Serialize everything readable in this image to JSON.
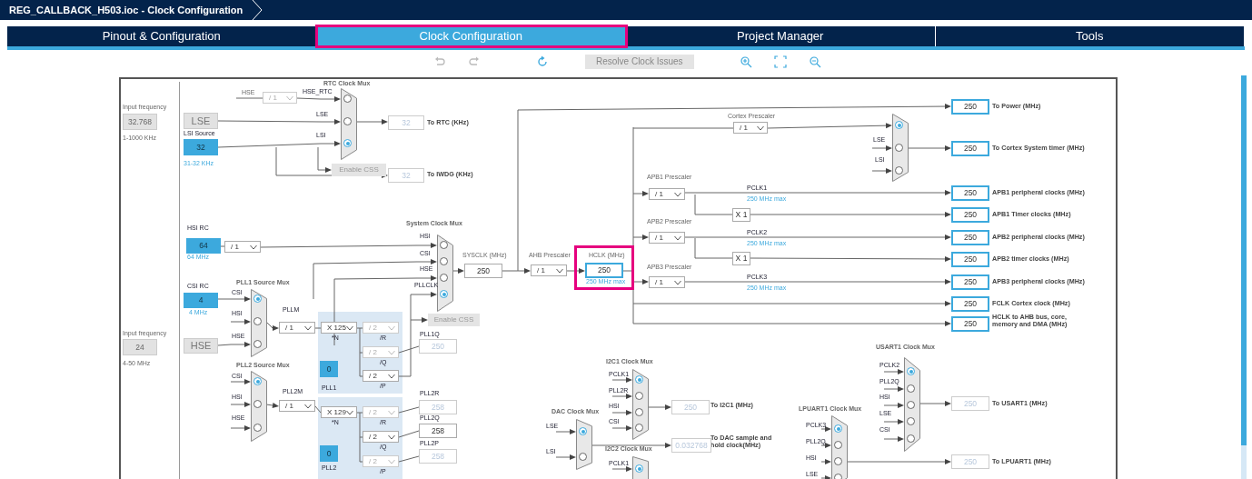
{
  "window": {
    "title": "REG_CALLBACK_H503.ioc - Clock Configuration"
  },
  "tabs": [
    {
      "label": "Pinout & Configuration",
      "selected": false
    },
    {
      "label": "Clock Configuration",
      "selected": true,
      "highlighted": true
    },
    {
      "label": "Project Manager",
      "selected": false
    },
    {
      "label": "Tools",
      "selected": false
    }
  ],
  "toolbar": {
    "resolve_button": {
      "label": "Resolve Clock Issues",
      "disabled": true
    }
  },
  "diagram": {
    "labels": [
      {
        "text": "Input frequency",
        "kind": "caption"
      },
      {
        "text": "1-1000 KHz",
        "kind": "caption"
      },
      {
        "text": "LSI Source",
        "kind": "signal"
      },
      {
        "text": "31-32 KHz",
        "kind": "range"
      },
      {
        "text": "HSE",
        "kind": "caption"
      },
      {
        "text": "To RTC (KHz)",
        "kind": "output"
      },
      {
        "text": "To IWDG (KHz)",
        "kind": "output"
      },
      {
        "text": "HSI RC",
        "kind": "signal"
      },
      {
        "text": "64 MHz",
        "kind": "range"
      },
      {
        "text": "CSI RC",
        "kind": "signal"
      },
      {
        "text": "4 MHz",
        "kind": "range"
      },
      {
        "text": "Input frequency",
        "kind": "caption"
      },
      {
        "text": "4-50 MHz",
        "kind": "caption"
      },
      {
        "text": "PLLM",
        "kind": "signal"
      },
      {
        "text": "*N",
        "kind": "signal"
      },
      {
        "text": "/R",
        "kind": "signal"
      },
      {
        "text": "/Q",
        "kind": "signal"
      },
      {
        "text": "/P",
        "kind": "signal"
      },
      {
        "text": "PLL1",
        "kind": "signal"
      },
      {
        "text": "PLL2M",
        "kind": "signal"
      },
      {
        "text": "*N",
        "kind": "signal"
      },
      {
        "text": "/R",
        "kind": "signal"
      },
      {
        "text": "/Q",
        "kind": "signal"
      },
      {
        "text": "PLL2",
        "kind": "signal"
      },
      {
        "text": "/P",
        "kind": "signal"
      },
      {
        "text": "PLL1Q",
        "kind": "signal"
      },
      {
        "text": "PLL2R",
        "kind": "signal"
      },
      {
        "text": "PLL2Q",
        "kind": "signal"
      },
      {
        "text": "PLL2P",
        "kind": "signal"
      },
      {
        "text": "SYSCLK (MHz)",
        "kind": "caption"
      },
      {
        "text": "AHB Prescaler",
        "kind": "caption"
      },
      {
        "text": "HCLK (MHz)",
        "kind": "caption"
      },
      {
        "text": "250 MHz max",
        "kind": "range"
      },
      {
        "text": "APB1 Prescaler",
        "kind": "caption"
      },
      {
        "text": "APB2 Prescaler",
        "kind": "caption"
      },
      {
        "text": "APB3 Prescaler",
        "kind": "caption"
      },
      {
        "text": "Cortex Prescaler",
        "kind": "caption"
      },
      {
        "text": "PCLK1",
        "kind": "signal"
      },
      {
        "text": "250 MHz max",
        "kind": "range"
      },
      {
        "text": "PCLK2",
        "kind": "signal"
      },
      {
        "text": "250 MHz max",
        "kind": "range"
      },
      {
        "text": "PCLK3",
        "kind": "signal"
      },
      {
        "text": "250 MHz max",
        "kind": "range"
      },
      {
        "text": "To Power (MHz)",
        "kind": "output"
      },
      {
        "text": "To Cortex System timer (MHz)",
        "kind": "output"
      },
      {
        "text": "APB1 peripheral clocks (MHz)",
        "kind": "output"
      },
      {
        "text": "APB1 Timer clocks (MHz)",
        "kind": "output"
      },
      {
        "text": "APB2 peripheral clocks (MHz)",
        "kind": "output"
      },
      {
        "text": "APB2 timer clocks (MHz)",
        "kind": "output"
      },
      {
        "text": "APB3 peripheral clocks (MHz)",
        "kind": "output"
      },
      {
        "text": "FCLK Cortex clock (MHz)",
        "kind": "output"
      },
      {
        "text": "HCLK to AHB bus, core, memory and DMA (MHz)",
        "kind": "output"
      },
      {
        "text": "To I2C1 (MHz)",
        "kind": "output"
      },
      {
        "text": "To DAC sample and hold clock(MHz)",
        "kind": "output"
      },
      {
        "text": "To USART1 (MHz)",
        "kind": "output"
      },
      {
        "text": "To LPUART1 (MHz)",
        "kind": "output"
      }
    ],
    "values": [
      {
        "value": "32.768",
        "kind": "input"
      },
      {
        "value": "LSE",
        "kind": "inactive"
      },
      {
        "value": "32",
        "kind": "source"
      },
      {
        "value": "32",
        "kind": "disabled"
      },
      {
        "value": "32",
        "kind": "disabled"
      },
      {
        "value": "64",
        "kind": "source"
      },
      {
        "value": "4",
        "kind": "source"
      },
      {
        "value": "24",
        "kind": "input"
      },
      {
        "value": "HSE",
        "kind": "inactive"
      },
      {
        "value": "0",
        "kind": "source"
      },
      {
        "value": "0",
        "kind": "source"
      },
      {
        "value": "250",
        "kind": "disabled"
      },
      {
        "value": "258",
        "kind": "disabled"
      },
      {
        "value": "258",
        "kind": "plain"
      },
      {
        "value": "258",
        "kind": "disabled"
      },
      {
        "value": "250",
        "kind": "plain"
      },
      {
        "value": "250",
        "kind": "active",
        "highlighted": true
      },
      {
        "value": "X 1",
        "kind": "plain"
      },
      {
        "value": "X 1",
        "kind": "plain"
      },
      {
        "value": "250",
        "kind": "active"
      },
      {
        "value": "250",
        "kind": "active"
      },
      {
        "value": "250",
        "kind": "active"
      },
      {
        "value": "250",
        "kind": "active"
      },
      {
        "value": "250",
        "kind": "active"
      },
      {
        "value": "250",
        "kind": "active"
      },
      {
        "value": "250",
        "kind": "active"
      },
      {
        "value": "250",
        "kind": "active"
      },
      {
        "value": "250",
        "kind": "active"
      },
      {
        "value": "250",
        "kind": "disabled"
      },
      {
        "value": "0.032768",
        "kind": "disabled"
      },
      {
        "value": "250",
        "kind": "disabled"
      },
      {
        "value": "250",
        "kind": "disabled"
      }
    ],
    "dropdowns": [
      {
        "value": "/ 1",
        "disabled": true
      },
      {
        "value": "/ 1",
        "disabled": false
      },
      {
        "value": "/ 1",
        "disabled": false
      },
      {
        "value": "X 125",
        "disabled": false
      },
      {
        "value": "/ 2",
        "disabled": true
      },
      {
        "value": "/ 2",
        "disabled": true
      },
      {
        "value": "/ 2",
        "disabled": false
      },
      {
        "value": "/ 1",
        "disabled": false
      },
      {
        "value": "X 129",
        "disabled": false
      },
      {
        "value": "/ 2",
        "disabled": true
      },
      {
        "value": "/ 2",
        "disabled": false
      },
      {
        "value": "/ 2",
        "disabled": true
      },
      {
        "value": "/ 1",
        "disabled": false
      },
      {
        "value": "/ 1",
        "disabled": false
      },
      {
        "value": "/ 1",
        "disabled": false
      },
      {
        "value": "/ 1",
        "disabled": false
      },
      {
        "value": "/ 1",
        "disabled": false
      }
    ],
    "buttons": [
      {
        "label": "Enable CSS",
        "disabled": true
      },
      {
        "label": "Enable CSS",
        "disabled": true
      }
    ],
    "muxes": [
      {
        "title": "RTC Clock Mux",
        "inputs": [
          {
            "label": "HSE_RTC",
            "selected": false
          },
          {
            "label": "LSE",
            "selected": false
          },
          {
            "label": "LSI",
            "selected": true
          }
        ]
      },
      {
        "title": "System Clock Mux",
        "inputs": [
          {
            "label": "HSI",
            "selected": false
          },
          {
            "label": "CSI",
            "selected": false
          },
          {
            "label": "HSE",
            "selected": false
          },
          {
            "label": "PLLCLK",
            "selected": true
          }
        ]
      },
      {
        "title": "PLL1 Source Mux",
        "inputs": [
          {
            "label": "CSI",
            "selected": true
          },
          {
            "label": "HSI",
            "selected": false
          },
          {
            "label": "HSE",
            "selected": false
          }
        ]
      },
      {
        "title": "PLL2 Source Mux",
        "inputs": [
          {
            "label": "CSI",
            "selected": true
          },
          {
            "label": "HSI",
            "selected": false
          },
          {
            "label": "HSE",
            "selected": false
          }
        ]
      },
      {
        "inputs": [
          {
            "selected": true
          },
          {
            "label": "LSE",
            "selected": false
          },
          {
            "label": "LSI",
            "selected": false
          }
        ]
      },
      {
        "title": "I2C1 Clock Mux",
        "inputs": [
          {
            "label": "PCLK1",
            "selected": true
          },
          {
            "label": "PLL2R",
            "selected": false
          },
          {
            "label": "HSI",
            "selected": false
          },
          {
            "label": "CSI",
            "selected": false
          }
        ]
      },
      {
        "title": "DAC Clock Mux",
        "inputs": [
          {
            "label": "LSE",
            "selected": true
          },
          {
            "label": "LSI",
            "selected": false
          }
        ]
      },
      {
        "title": "I2C2 Clock Mux",
        "inputs": [
          {
            "label": "PCLK1",
            "selected": true
          }
        ]
      },
      {
        "title": "USART1 Clock Mux",
        "inputs": [
          {
            "label": "PCLK2",
            "selected": true
          },
          {
            "label": "PLL2Q",
            "selected": false
          },
          {
            "label": "HSI",
            "selected": false
          },
          {
            "label": "LSE",
            "selected": false
          },
          {
            "label": "CSI",
            "selected": false
          }
        ]
      },
      {
        "title": "LPUART1 Clock Mux",
        "inputs": [
          {
            "label": "PCLK3",
            "selected": true
          },
          {
            "label": "PLL2Q",
            "selected": false
          },
          {
            "label": "HSI",
            "selected": false
          },
          {
            "label": "LSE",
            "selected": false
          }
        ]
      }
    ]
  }
}
